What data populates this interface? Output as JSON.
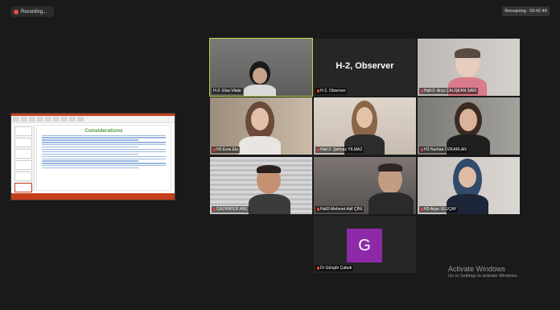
{
  "recording": {
    "label": "Recording..."
  },
  "remaining": {
    "label": "Remaining : 09:42:49"
  },
  "shared_screen": {
    "slide_title": "Considerations"
  },
  "participants": [
    {
      "name": "H-2- Elsa Vitale"
    },
    {
      "name": "H-2, Observer",
      "center_text": "H-2, Observer"
    },
    {
      "name": "Hall-2- Arzu ÇALIŞKAN SARI"
    },
    {
      "name": "H2-Esra Ela"
    },
    {
      "name": "Hall-2- Şehnaz YILMAZ"
    },
    {
      "name": "H2-Nurhan ÖZKARLAN"
    },
    {
      "name": "GAZANFER ANIL"
    },
    {
      "name": "Hall2-Mehmet Akif ÇİNİ"
    },
    {
      "name": "H2-Ayşe ULUÇAY"
    },
    {
      "name": "Dr Güngör Çabuk",
      "avatar_letter": "G"
    }
  ],
  "watermark": {
    "line1": "Activate Windows",
    "line2": "Go to Settings to activate Windows."
  },
  "colors": {
    "accent_green": "#b6d54a",
    "avatar_purple": "#8e2aa8",
    "mic_muted": "#e0433f",
    "ppt_red": "#c43e1c"
  }
}
